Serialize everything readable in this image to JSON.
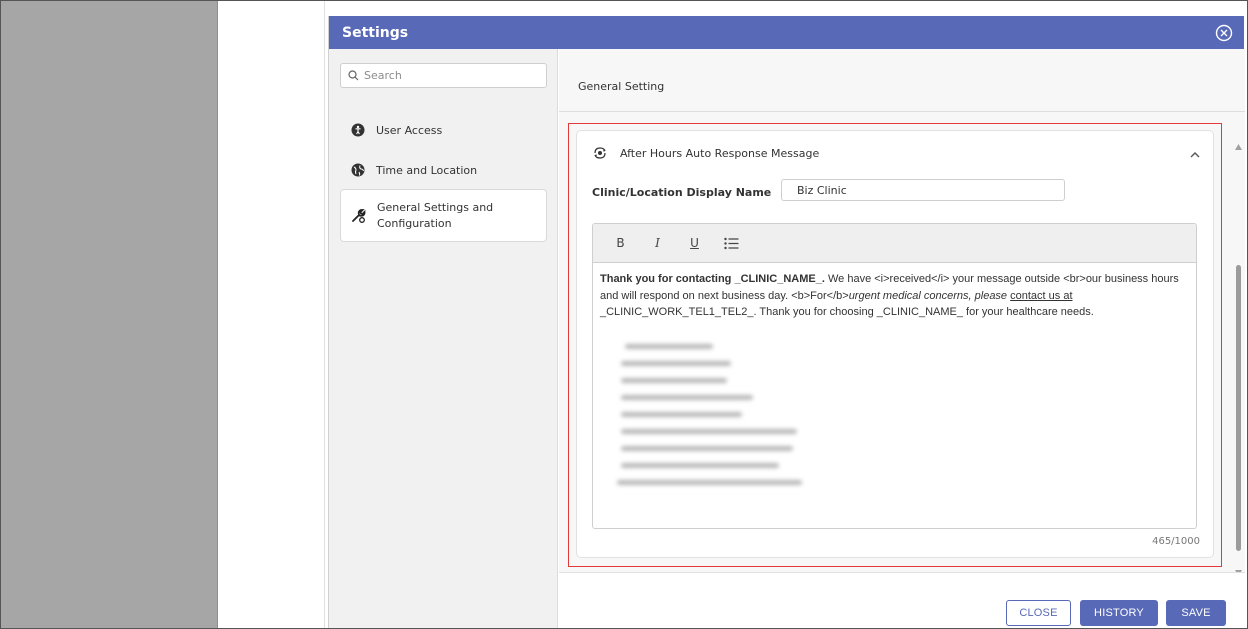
{
  "dialog": {
    "title": "Settings"
  },
  "sidebar": {
    "search_placeholder": "Search",
    "items": [
      {
        "label": "User Access",
        "icon": "user-access-icon"
      },
      {
        "label": "Time and Location",
        "icon": "globe-icon"
      },
      {
        "label": "General Settings and Configuration",
        "line1": "General Settings and",
        "line2": "Configuration",
        "icon": "wrench-gear-icon",
        "active": true
      }
    ]
  },
  "main": {
    "section_title": "General Setting",
    "card": {
      "title": "After Hours Auto Response Message",
      "field_label": "Clinic/Location Display Name",
      "field_value": "Biz Clinic",
      "toolbar": {
        "bold": "B",
        "italic": "I",
        "underline": "U"
      },
      "message": {
        "bold_part": "Thank you for contacting _CLINIC_NAME_.",
        "part2": " We have <i>received</i> your message outside <br>our business hours and will respond on next business day. <b>For</b>",
        "italic_part": "urgent medical concerns, please",
        "underline_part": "contact us at",
        "part3": " _CLINIC_WORK_TEL1_TEL2_. Thank you for choosing _CLINIC_NAME_ for your healthcare needs."
      },
      "char_count": "465/1000"
    }
  },
  "footer": {
    "close_label": "CLOSE",
    "history_label": "HISTORY",
    "save_label": "SAVE"
  },
  "colors": {
    "header": "#5869b7",
    "highlight": "#e03a3a"
  }
}
